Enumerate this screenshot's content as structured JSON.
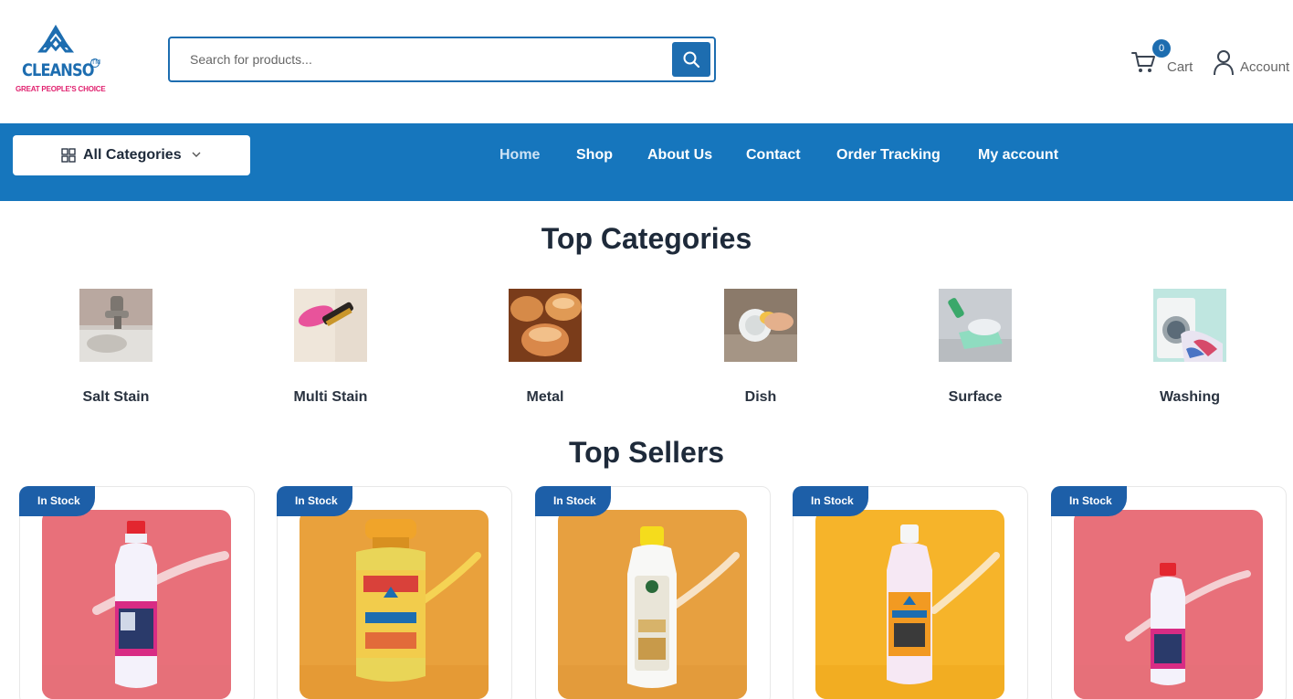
{
  "header": {
    "logo": {
      "brand": "CLEANSO",
      "trademark": "TM",
      "tagline": "GREAT PEOPLE'S CHOICE"
    },
    "search": {
      "placeholder": "Search for products..."
    },
    "cart": {
      "count": "0",
      "label": "Cart"
    },
    "account": {
      "label": "Account"
    }
  },
  "nav": {
    "all_categories": "All Categories",
    "links": [
      "Home",
      "Shop",
      "About Us",
      "Contact",
      "Order Tracking",
      "My account"
    ],
    "active": "Home"
  },
  "top_categories": {
    "title": "Top Categories",
    "items": [
      {
        "name": "Salt Stain"
      },
      {
        "name": "Multi Stain"
      },
      {
        "name": "Metal"
      },
      {
        "name": "Dish"
      },
      {
        "name": "Surface"
      },
      {
        "name": "Washing"
      }
    ]
  },
  "top_sellers": {
    "title": "Top Sellers",
    "products": [
      {
        "badge": "In Stock",
        "bg": "#e8707a"
      },
      {
        "badge": "In Stock",
        "bg": "#e9a13c"
      },
      {
        "badge": "In Stock",
        "bg": "#e7a040"
      },
      {
        "badge": "In Stock",
        "bg": "#f6b42a"
      },
      {
        "badge": "In Stock",
        "bg": "#e8707a"
      }
    ]
  },
  "colors": {
    "primary": "#1676bd",
    "badge": "#1d5fa8",
    "tagline": "#e0206e"
  }
}
